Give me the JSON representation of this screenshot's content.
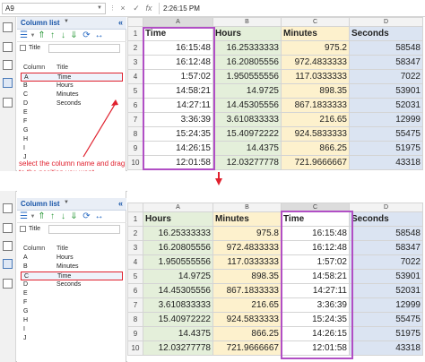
{
  "top": {
    "formula_bar": {
      "name_box": "A9",
      "cell_value": "2:26:15 PM",
      "cancel_glyph": "×",
      "confirm_glyph": "✓",
      "fx_glyph": "fx"
    },
    "pane": {
      "title": "Column list",
      "close_glyph": "«",
      "search_label": "Title",
      "col_header": "Column",
      "title_header": "Title",
      "rows": [
        {
          "col": "A",
          "name": "Time",
          "selected": true
        },
        {
          "col": "B",
          "name": "Hours",
          "selected": false
        },
        {
          "col": "C",
          "name": "Minutes",
          "selected": false
        },
        {
          "col": "D",
          "name": "Seconds",
          "selected": false
        },
        {
          "col": "E",
          "name": "",
          "selected": false
        },
        {
          "col": "F",
          "name": "",
          "selected": false
        },
        {
          "col": "G",
          "name": "",
          "selected": false
        },
        {
          "col": "H",
          "name": "",
          "selected": false
        },
        {
          "col": "I",
          "name": "",
          "selected": false
        },
        {
          "col": "J",
          "name": "",
          "selected": false
        }
      ],
      "note": "select the column name and drag to the position you want"
    },
    "sheet": {
      "col_letters": [
        "A",
        "B",
        "C",
        "D"
      ],
      "headers": [
        "Time",
        "Hours",
        "Minutes",
        "Seconds"
      ],
      "rows": [
        {
          "n": "2",
          "cells": [
            "16:15:48",
            "16.25333333",
            "975.2",
            "58548"
          ]
        },
        {
          "n": "3",
          "cells": [
            "16:12:48",
            "16.20805556",
            "972.4833333",
            "58347"
          ]
        },
        {
          "n": "4",
          "cells": [
            "1:57:02",
            "1.950555556",
            "117.0333333",
            "7022"
          ]
        },
        {
          "n": "5",
          "cells": [
            "14:58:21",
            "14.9725",
            "898.35",
            "53901"
          ]
        },
        {
          "n": "6",
          "cells": [
            "14:27:11",
            "14.45305556",
            "867.1833333",
            "52031"
          ]
        },
        {
          "n": "7",
          "cells": [
            "3:36:39",
            "3.610833333",
            "216.65",
            "12999"
          ]
        },
        {
          "n": "8",
          "cells": [
            "15:24:35",
            "15.40972222",
            "924.5833333",
            "55475"
          ]
        },
        {
          "n": "9",
          "cells": [
            "14:26:15",
            "14.4375",
            "866.25",
            "51975"
          ]
        },
        {
          "n": "10",
          "cells": [
            "12:01:58",
            "12.03277778",
            "721.9666667",
            "43318"
          ]
        }
      ]
    }
  },
  "bottom": {
    "pane": {
      "title": "Column list",
      "close_glyph": "«",
      "search_label": "Title",
      "col_header": "Column",
      "title_header": "Title",
      "rows": [
        {
          "col": "A",
          "name": "Hours",
          "selected": false
        },
        {
          "col": "B",
          "name": "Minutes",
          "selected": false
        },
        {
          "col": "C",
          "name": "Time",
          "selected": true
        },
        {
          "col": "D",
          "name": "Seconds",
          "selected": false
        },
        {
          "col": "E",
          "name": "",
          "selected": false
        },
        {
          "col": "F",
          "name": "",
          "selected": false
        },
        {
          "col": "G",
          "name": "",
          "selected": false
        },
        {
          "col": "H",
          "name": "",
          "selected": false
        },
        {
          "col": "I",
          "name": "",
          "selected": false
        },
        {
          "col": "J",
          "name": "",
          "selected": false
        }
      ]
    },
    "sheet": {
      "col_letters": [
        "A",
        "B",
        "C",
        "D"
      ],
      "headers": [
        "Hours",
        "Minutes",
        "Time",
        "Seconds"
      ],
      "rows": [
        {
          "n": "2",
          "cells": [
            "16.25333333",
            "975.8",
            "16:15:48",
            "58548"
          ]
        },
        {
          "n": "3",
          "cells": [
            "16.20805556",
            "972.4833333",
            "16:12:48",
            "58347"
          ]
        },
        {
          "n": "4",
          "cells": [
            "1.950555556",
            "117.0333333",
            "1:57:02",
            "7022"
          ]
        },
        {
          "n": "5",
          "cells": [
            "14.9725",
            "898.35",
            "14:58:21",
            "53901"
          ]
        },
        {
          "n": "6",
          "cells": [
            "14.45305556",
            "867.1833333",
            "14:27:11",
            "52031"
          ]
        },
        {
          "n": "7",
          "cells": [
            "3.610833333",
            "216.65",
            "3:36:39",
            "12999"
          ]
        },
        {
          "n": "8",
          "cells": [
            "15.40972222",
            "924.5833333",
            "15:24:35",
            "55475"
          ]
        },
        {
          "n": "9",
          "cells": [
            "14.4375",
            "866.25",
            "14:26:15",
            "51975"
          ]
        },
        {
          "n": "10",
          "cells": [
            "12.03277778",
            "721.9666667",
            "12:01:58",
            "43318"
          ]
        }
      ]
    }
  },
  "colors": {
    "highlight": "#b14fc5",
    "annotation_red": "#e0212e",
    "hours_fill": "#e4efda",
    "minutes_fill": "#fdf1cd",
    "seconds_fill": "#dbe4f2",
    "pane_title": "#1a56a8"
  }
}
